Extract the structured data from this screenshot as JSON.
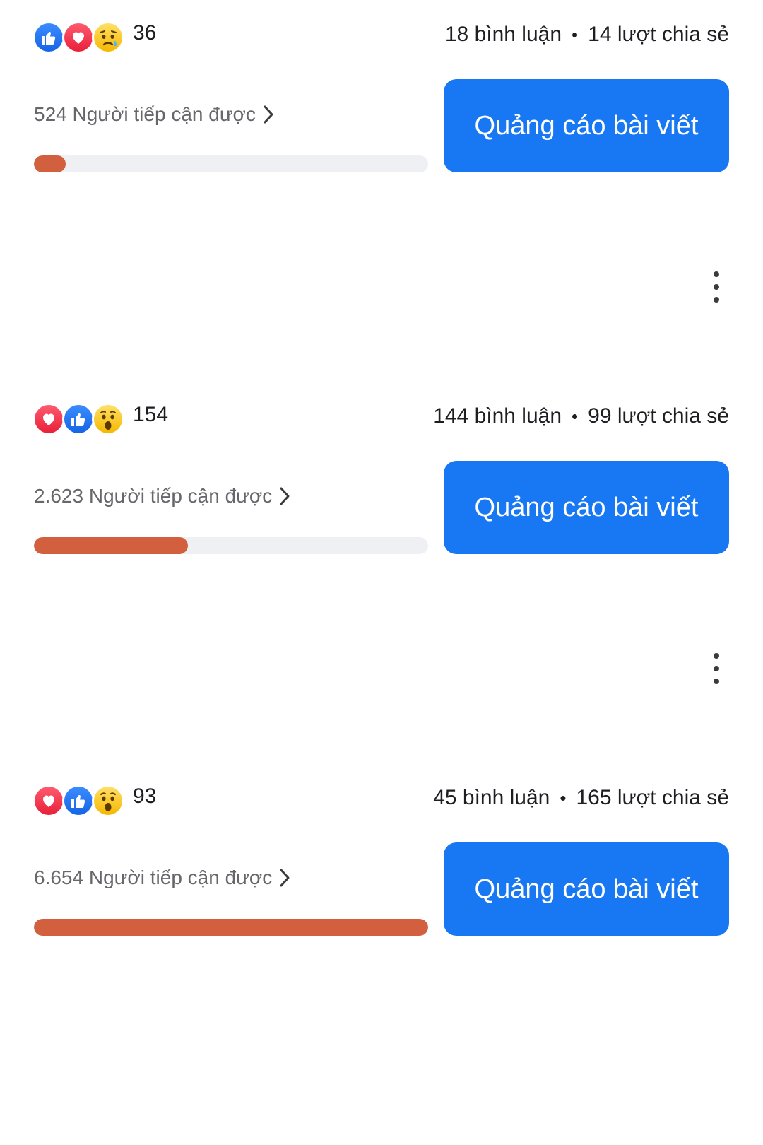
{
  "posts": [
    {
      "reactions": [
        "like-icon",
        "love-icon",
        "sad-icon"
      ],
      "reaction_count": "36",
      "comments": "18 bình luận",
      "separator": "•",
      "shares": "14 lượt chia sẻ",
      "reach": "524 Người tiếp cận được",
      "reach_progress_percent": 8,
      "boost_label": "Quảng cáo bài viết"
    },
    {
      "reactions": [
        "love-icon",
        "like-icon",
        "wow-icon"
      ],
      "reaction_count": "154",
      "comments": "144 bình luận",
      "separator": "•",
      "shares": "99 lượt chia sẻ",
      "reach": "2.623 Người tiếp cận được",
      "reach_progress_percent": 39,
      "boost_label": "Quảng cáo bài viết"
    },
    {
      "reactions": [
        "love-icon",
        "like-icon",
        "wow-icon"
      ],
      "reaction_count": "93",
      "comments": "45 bình luận",
      "separator": "•",
      "shares": "165 lượt chia sẻ",
      "reach": "6.654 Người tiếp cận được",
      "reach_progress_percent": 100,
      "boost_label": "Quảng cáo bài viết"
    }
  ],
  "colors": {
    "boost_button": "#1877f2",
    "progress_fill": "#d2603f",
    "progress_track": "#eef0f3",
    "secondary_text": "#65676b"
  }
}
